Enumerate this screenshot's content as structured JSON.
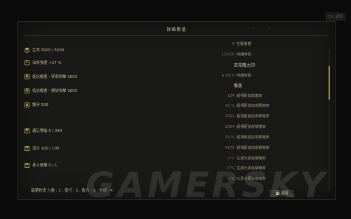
{
  "corner": {
    "label": "Esc 返回"
  },
  "panel": {
    "title": "詳細數值",
    "dots": [
      "◇",
      "◇"
    ]
  },
  "left_stats": [
    {
      "icon": "heart-icon",
      "glyph": "♥",
      "label": "生命 5500 / 5500"
    },
    {
      "icon": "flame-icon",
      "glyph": "✦",
      "label": "法術強度 +27 %"
    },
    {
      "icon": "shield-icon",
      "glyph": "◆",
      "label": "抵抗傷害 - 穿刺攻擊 1603"
    },
    {
      "icon": "armor-icon",
      "glyph": "◆",
      "label": "抵抗傷害 - 劈砍攻擊 1603"
    },
    {
      "icon": "helmet-icon",
      "glyph": "▲",
      "label": "護甲 506"
    },
    {
      "icon": "gear-icon",
      "glyph": "✱",
      "label": "遺忘等級 0 / 240"
    },
    {
      "icon": "stamina-icon",
      "glyph": "✚",
      "label": "活力 100 / 100"
    },
    {
      "icon": "sword-icon",
      "glyph": "✚",
      "label": "身上裝備 0 / 1"
    }
  ],
  "right_rows": [
    {
      "val": "0",
      "label": "生動傷害",
      "head": false
    },
    {
      "val": "1197/0",
      "label": "持續時間",
      "head": false
    },
    {
      "val": "",
      "label": "亞克隆之印",
      "head": true
    },
    {
      "val": "6.3/6.0",
      "label": "持續時間",
      "head": false
    },
    {
      "val": "",
      "label": "傷害",
      "head": true
    },
    {
      "val": "104",
      "label": "超視距加傷害率",
      "head": false
    },
    {
      "val": "13 %",
      "label": "超視距追加攻擊機率",
      "head": false
    },
    {
      "val": "2321",
      "label": "超視距追加攻擊機率",
      "head": false
    },
    {
      "val": "2064",
      "label": "超視距加攻擊機率",
      "head": false
    },
    {
      "val": "13 %",
      "label": "超視距追加攻擊機率",
      "head": false
    },
    {
      "val": "4375",
      "label": "超視距追加攻擊機率",
      "head": false
    },
    {
      "val": "0 %",
      "label": "生成元素追擊機率",
      "head": false
    },
    {
      "val": "0 %",
      "label": "生成元素追擊機率",
      "head": false
    },
    {
      "val": "0 %",
      "label": "元素元素追擊機率",
      "head": false
    }
  ],
  "footer": {
    "text": "基礎數值 力量 : 1 , 靈巧 : 3 , 智力 : 3 , 信仰 : 4",
    "button_key": "Q",
    "button_label": "返回"
  },
  "watermark": "GAMERSKY"
}
